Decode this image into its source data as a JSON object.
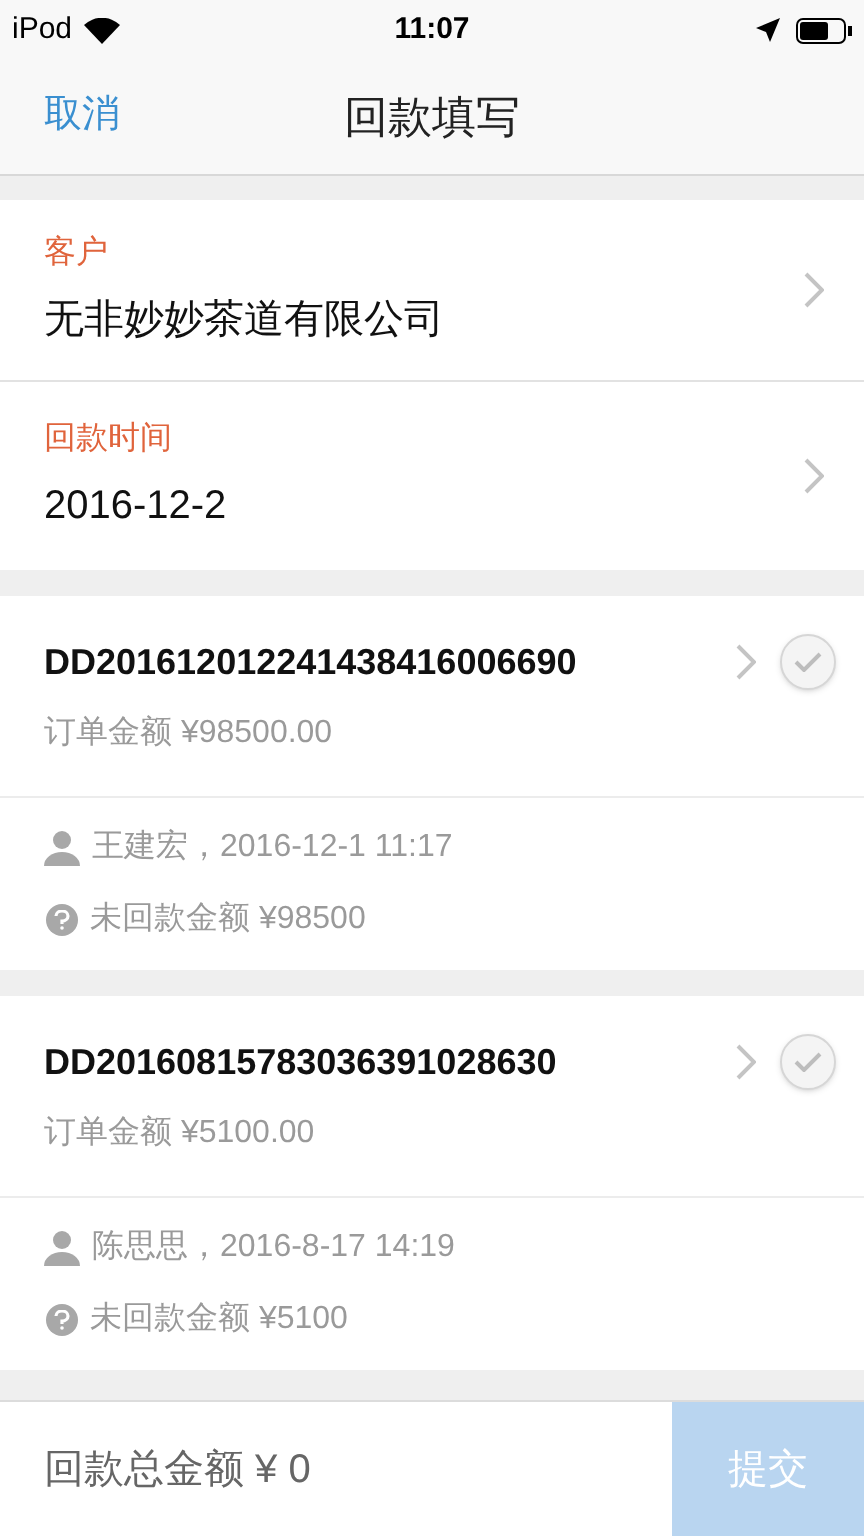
{
  "status_bar": {
    "carrier": "iPod",
    "time": "11:07"
  },
  "nav": {
    "cancel": "取消",
    "title": "回款填写"
  },
  "fields": [
    {
      "label": "客户",
      "value": "无非妙妙茶道有限公司"
    },
    {
      "label": "回款时间",
      "value": "2016-12-2"
    }
  ],
  "orders": [
    {
      "number": "DD201612012241438416006690",
      "amount": "订单金额 ¥98500.00",
      "person": "王建宏，2016-12-1 11:17",
      "unpaid": "未回款金额 ¥98500",
      "checked": false
    },
    {
      "number": "DD20160815783036391028630",
      "amount": "订单金额 ¥5100.00",
      "person": "陈思思，2016-8-17 14:19",
      "unpaid": "未回款金额 ¥5100",
      "checked": false
    }
  ],
  "footer": {
    "total": "回款总金额 ¥ 0",
    "submit": "提交",
    "submit_disabled": true
  }
}
